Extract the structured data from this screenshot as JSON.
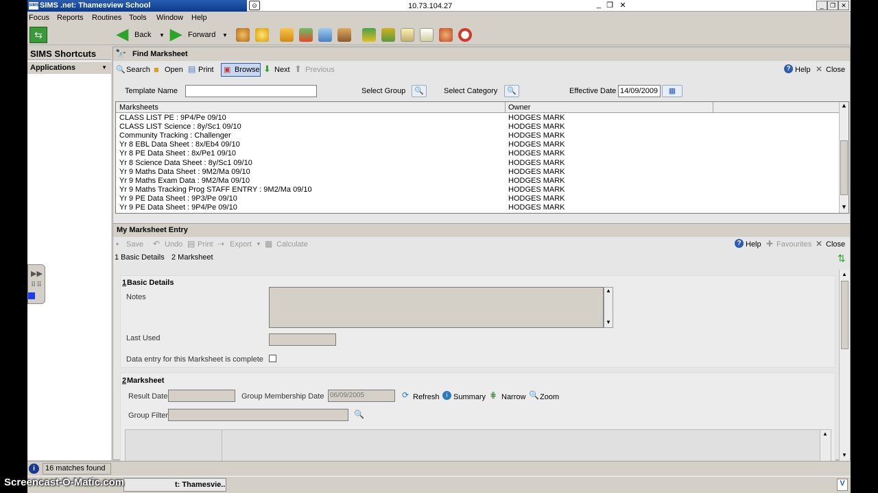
{
  "window": {
    "app_title": "SIMS .net: Thamesview School",
    "app_badge": "SIMS",
    "remote_address": "10.73.104.27"
  },
  "menu": [
    "Focus",
    "Reports",
    "Routines",
    "Tools",
    "Window",
    "Help"
  ],
  "toolbar": {
    "back_label": "Back",
    "forward_label": "Forward"
  },
  "shortcuts": {
    "title": "SIMS Shortcuts",
    "applications": "Applications"
  },
  "find_marksheet": {
    "title": "Find Marksheet",
    "actions": {
      "search": "Search",
      "open": "Open",
      "print": "Print",
      "browse": "Browse",
      "next": "Next",
      "previous": "Previous",
      "help": "Help",
      "close": "Close"
    },
    "filters": {
      "template_name_label": "Template Name",
      "template_name_value": "",
      "select_group_label": "Select Group",
      "select_category_label": "Select Category",
      "effective_date_label": "Effective Date",
      "effective_date_value": "14/09/2009"
    },
    "columns": [
      "Marksheets",
      "Owner"
    ],
    "rows": [
      {
        "marksheet": "CLASS LIST PE : 9P4/Pe 09/10",
        "owner": "HODGES MARK"
      },
      {
        "marksheet": "CLASS LIST Science : 8y/Sc1 09/10",
        "owner": "HODGES MARK"
      },
      {
        "marksheet": "Community Tracking : Challenger",
        "owner": "HODGES MARK"
      },
      {
        "marksheet": "Yr 8 EBL Data Sheet : 8x/Eb4 09/10",
        "owner": "HODGES MARK"
      },
      {
        "marksheet": "Yr 8 PE Data Sheet : 8x/Pe1 09/10",
        "owner": "HODGES MARK"
      },
      {
        "marksheet": "Yr 8 Science Data Sheet : 8y/Sc1 09/10",
        "owner": "HODGES MARK"
      },
      {
        "marksheet": "Yr 9 Maths Data Sheet : 9M2/Ma 09/10",
        "owner": "HODGES MARK"
      },
      {
        "marksheet": "Yr 9 Maths Exam Data : 9M2/Ma 09/10",
        "owner": "HODGES MARK"
      },
      {
        "marksheet": "Yr 9 Maths Tracking Prog STAFF ENTRY : 9M2/Ma 09/10",
        "owner": "HODGES MARK"
      },
      {
        "marksheet": "Yr 9 PE Data Sheet : 9P3/Pe 09/10",
        "owner": "HODGES MARK"
      },
      {
        "marksheet": "Yr 9 PE Data Sheet : 9P4/Pe 09/10",
        "owner": "HODGES MARK"
      }
    ]
  },
  "entry": {
    "title": "My Marksheet Entry",
    "actions": {
      "save": "Save",
      "undo": "Undo",
      "print": "Print",
      "export": "Export",
      "calculate": "Calculate",
      "help": "Help",
      "favourites": "Favourites",
      "close": "Close"
    },
    "links": [
      "1 Basic Details",
      "2 Marksheet"
    ],
    "basic": {
      "title_num": "1",
      "title": " Basic Details",
      "notes_label": "Notes",
      "last_used_label": "Last Used",
      "complete_label": "Data entry for this Marksheet is complete"
    },
    "marksheet": {
      "title_num": "2",
      "title": " Marksheet",
      "result_date_label": "Result Date",
      "group_membership_label": "Group Membership Date",
      "group_membership_value": "06/09/2005",
      "refresh": "Refresh",
      "summary": "Summary",
      "narrow": "Narrow",
      "zoom": "Zoom",
      "group_filter_label": "Group Filter"
    }
  },
  "status": {
    "matches": "16 matches found"
  },
  "taskbar": {
    "watermark": "Screencast-O-Matic.com",
    "task_label": "t: Thamesvie..."
  },
  "colors": {
    "title_blue": "#2a5db0",
    "chrome_gray": "#d4d0c8",
    "arrow_green": "#2aa52a"
  }
}
